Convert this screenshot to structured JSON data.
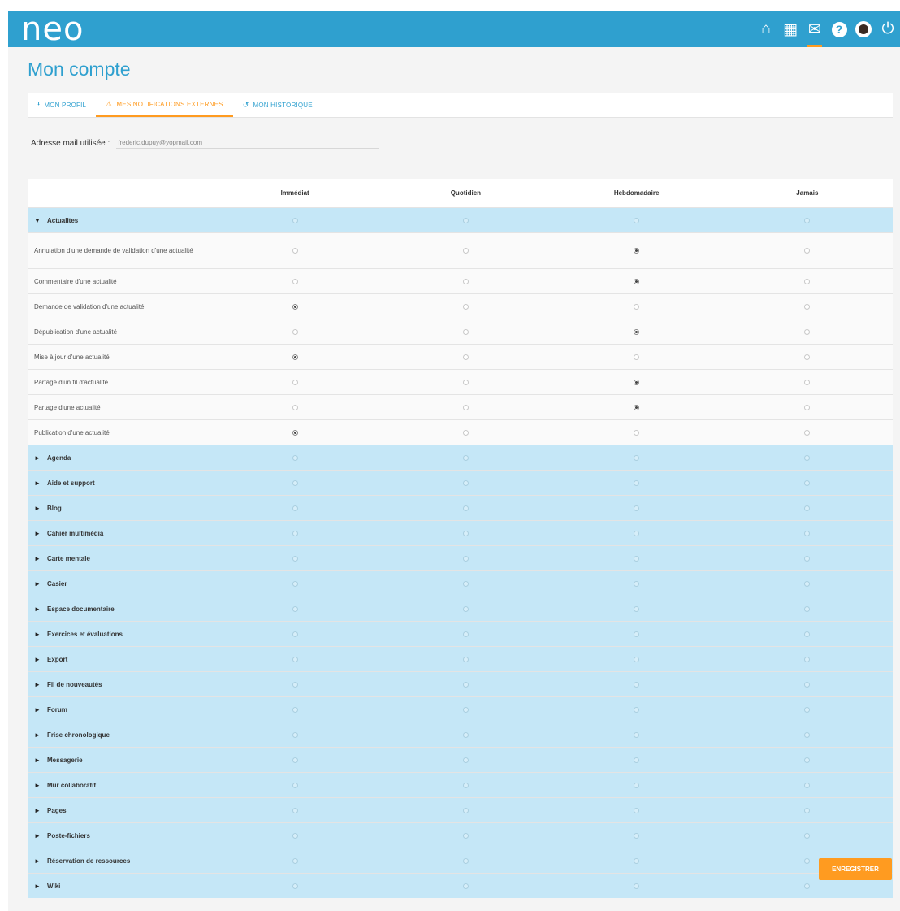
{
  "app": {
    "logo": "neo"
  },
  "header_icons": [
    {
      "icon": "home-icon",
      "glyph": "⌂"
    },
    {
      "icon": "apps-grid-icon",
      "glyph": "▦"
    },
    {
      "icon": "mail-icon",
      "glyph": "✉"
    },
    {
      "icon": "help-icon",
      "glyph": "?"
    },
    {
      "icon": "avatar-icon",
      "glyph": ""
    },
    {
      "icon": "power-icon",
      "glyph": "⏻"
    }
  ],
  "page_title": "Mon compte",
  "tabs": [
    {
      "icon": "⭳",
      "label": "Mon profil"
    },
    {
      "icon": "⚠",
      "label": "Mes notifications externes"
    },
    {
      "icon": "↺",
      "label": "Mon historique"
    }
  ],
  "email": {
    "label": "Adresse mail utilisée :",
    "value": "frederic.dupuy@yopmail.com"
  },
  "columns": [
    "Immédiat",
    "Quotidien",
    "Hebdomadaire",
    "Jamais"
  ],
  "rows": [
    {
      "type": "category",
      "expanded": true,
      "label": "Actualites",
      "selected": null
    },
    {
      "type": "item",
      "label": "Annulation d'une demande de validation d'une actualité",
      "selected": 2
    },
    {
      "type": "item",
      "label": "Commentaire d'une actualité",
      "selected": 2
    },
    {
      "type": "item",
      "label": "Demande de validation d'une actualité",
      "selected": 0
    },
    {
      "type": "item",
      "label": "Dépublication d'une actualité",
      "selected": 2
    },
    {
      "type": "item",
      "label": "Mise à jour d'une actualité",
      "selected": 0
    },
    {
      "type": "item",
      "label": "Partage d'un fil d'actualité",
      "selected": 2
    },
    {
      "type": "item",
      "label": "Partage d'une actualité",
      "selected": 2
    },
    {
      "type": "item",
      "label": "Publication d'une actualité",
      "selected": 0
    },
    {
      "type": "category",
      "expanded": false,
      "label": "Agenda",
      "selected": null
    },
    {
      "type": "category",
      "expanded": false,
      "label": "Aide et support",
      "selected": null
    },
    {
      "type": "category",
      "expanded": false,
      "label": "Blog",
      "selected": null
    },
    {
      "type": "category",
      "expanded": false,
      "label": "Cahier multimédia",
      "selected": null
    },
    {
      "type": "category",
      "expanded": false,
      "label": "Carte mentale",
      "selected": null
    },
    {
      "type": "category",
      "expanded": false,
      "label": "Casier",
      "selected": null
    },
    {
      "type": "category",
      "expanded": false,
      "label": "Espace documentaire",
      "selected": null
    },
    {
      "type": "category",
      "expanded": false,
      "label": "Exercices et évaluations",
      "selected": null
    },
    {
      "type": "category",
      "expanded": false,
      "label": "Export",
      "selected": null
    },
    {
      "type": "category",
      "expanded": false,
      "label": "Fil de nouveautés",
      "selected": null
    },
    {
      "type": "category",
      "expanded": false,
      "label": "Forum",
      "selected": null
    },
    {
      "type": "category",
      "expanded": false,
      "label": "Frise chronologique",
      "selected": null
    },
    {
      "type": "category",
      "expanded": false,
      "label": "Messagerie",
      "selected": null
    },
    {
      "type": "category",
      "expanded": false,
      "label": "Mur collaboratif",
      "selected": null
    },
    {
      "type": "category",
      "expanded": false,
      "label": "Pages",
      "selected": null
    },
    {
      "type": "category",
      "expanded": false,
      "label": "Poste-fichiers",
      "selected": null
    },
    {
      "type": "category",
      "expanded": false,
      "label": "Réservation de ressources",
      "selected": null
    },
    {
      "type": "category",
      "expanded": false,
      "label": "Wiki",
      "selected": null
    }
  ],
  "save_label": "Enregistrer",
  "colors": {
    "header": "#2fa0cf",
    "accent": "#ff9b20",
    "category_row": "#c5e7f7"
  }
}
